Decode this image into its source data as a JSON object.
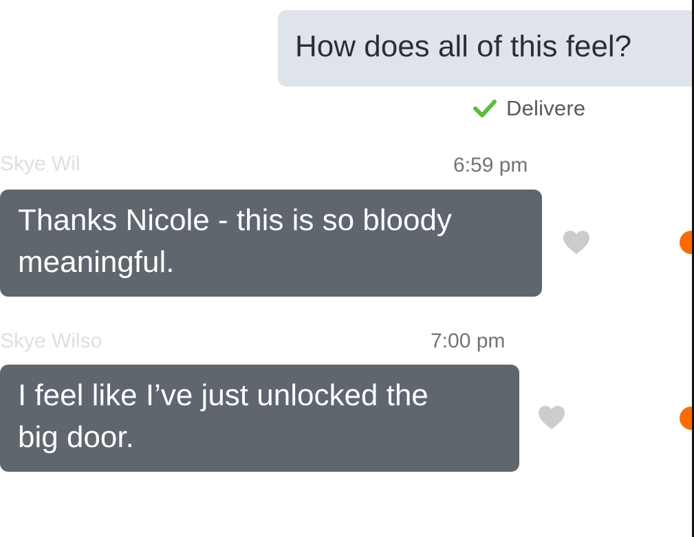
{
  "conversation": {
    "outgoing": {
      "text": "How does all of this feel?",
      "status": "Delivere"
    },
    "incoming": [
      {
        "sender": "Skye Wil",
        "time": "6:59 pm",
        "lines": [
          "Thanks Nicole - this is so bloody",
          "meaningful."
        ]
      },
      {
        "sender": "Skye Wilso",
        "time": "7:00 pm",
        "lines": [
          "I feel like I’ve just unlocked the",
          "big door."
        ]
      }
    ]
  },
  "icons": {
    "delivered": "check-icon",
    "like": "heart-icon",
    "unread": "unread-dot"
  },
  "colors": {
    "outgoing_bubble": "#dfe4ec",
    "incoming_bubble": "#5f666e",
    "check": "#5dbb3f",
    "heart": "#cccccc",
    "unread_dot": "#ff6a00"
  }
}
